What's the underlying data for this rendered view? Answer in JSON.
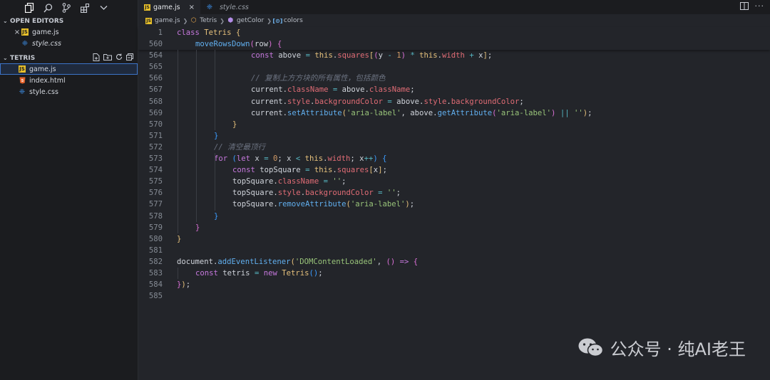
{
  "sidebar": {
    "open_editors_label": "OPEN EDITORS",
    "open_editors": [
      {
        "name": "game.js",
        "type": "js",
        "close": "×"
      },
      {
        "name": "style.css",
        "type": "css"
      }
    ],
    "folder_label": "TETRIS",
    "files": [
      {
        "name": "game.js",
        "type": "js"
      },
      {
        "name": "index.html",
        "type": "html"
      },
      {
        "name": "style.css",
        "type": "css"
      }
    ]
  },
  "tabs": [
    {
      "name": "game.js",
      "type": "js",
      "close": "×"
    },
    {
      "name": "style.css",
      "type": "css"
    }
  ],
  "breadcrumb": [
    "game.js",
    "Tetris",
    "getColor",
    "colors"
  ],
  "code": {
    "sticky_lines": [
      {
        "n": "1",
        "indent": 0,
        "tokens": [
          [
            "kw",
            "class "
          ],
          [
            "cls",
            "Tetris "
          ],
          [
            "b1",
            "{"
          ]
        ]
      },
      {
        "n": "560",
        "indent": 1,
        "tokens": [
          [
            "fn",
            "moveRowsDown"
          ],
          [
            "b2",
            "("
          ],
          [
            "p",
            "row"
          ],
          [
            "b2",
            ")"
          ],
          [
            "p",
            " "
          ],
          [
            "b2",
            "{"
          ]
        ]
      }
    ],
    "lines": [
      {
        "n": "564",
        "indent": 4,
        "tokens": [
          [
            "kw",
            "const "
          ],
          [
            "p",
            "above "
          ],
          [
            "op",
            "= "
          ],
          [
            "th",
            "this"
          ],
          [
            "p",
            "."
          ],
          [
            "prop",
            "squares"
          ],
          [
            "b1",
            "["
          ],
          [
            "b2",
            "("
          ],
          [
            "p",
            "y "
          ],
          [
            "op",
            "- "
          ],
          [
            "num",
            "1"
          ],
          [
            "b2",
            ")"
          ],
          [
            "p",
            " "
          ],
          [
            "op",
            "* "
          ],
          [
            "th",
            "this"
          ],
          [
            "p",
            "."
          ],
          [
            "prop",
            "width "
          ],
          [
            "op",
            "+ "
          ],
          [
            "p",
            "x"
          ],
          [
            "b1",
            "]"
          ],
          [
            "p",
            ";"
          ]
        ]
      },
      {
        "n": "565",
        "indent": 0,
        "tokens": []
      },
      {
        "n": "566",
        "indent": 4,
        "tokens": [
          [
            "cm",
            "// 复制上方方块的所有属性，包括颜色"
          ]
        ]
      },
      {
        "n": "567",
        "indent": 4,
        "tokens": [
          [
            "p",
            "current"
          ],
          [
            "p",
            "."
          ],
          [
            "prop",
            "className "
          ],
          [
            "op",
            "= "
          ],
          [
            "p",
            "above"
          ],
          [
            "p",
            "."
          ],
          [
            "prop",
            "className"
          ],
          [
            "p",
            ";"
          ]
        ]
      },
      {
        "n": "568",
        "indent": 4,
        "tokens": [
          [
            "p",
            "current"
          ],
          [
            "p",
            "."
          ],
          [
            "prop",
            "style"
          ],
          [
            "p",
            "."
          ],
          [
            "prop",
            "backgroundColor "
          ],
          [
            "op",
            "= "
          ],
          [
            "p",
            "above"
          ],
          [
            "p",
            "."
          ],
          [
            "prop",
            "style"
          ],
          [
            "p",
            "."
          ],
          [
            "prop",
            "backgroundColor"
          ],
          [
            "p",
            ";"
          ]
        ]
      },
      {
        "n": "569",
        "indent": 4,
        "tokens": [
          [
            "p",
            "current"
          ],
          [
            "p",
            "."
          ],
          [
            "fn",
            "setAttribute"
          ],
          [
            "b1",
            "("
          ],
          [
            "str",
            "'aria-label'"
          ],
          [
            "p",
            ", above."
          ],
          [
            "fn",
            "getAttribute"
          ],
          [
            "b2",
            "("
          ],
          [
            "str",
            "'aria-label'"
          ],
          [
            "b2",
            ")"
          ],
          [
            "p",
            " "
          ],
          [
            "op",
            "|| "
          ],
          [
            "str",
            "''"
          ],
          [
            "b1",
            ")"
          ],
          [
            "p",
            ";"
          ]
        ]
      },
      {
        "n": "570",
        "indent": 3,
        "tokens": [
          [
            "b1",
            "}"
          ]
        ]
      },
      {
        "n": "571",
        "indent": 2,
        "tokens": [
          [
            "b3",
            "}"
          ]
        ]
      },
      {
        "n": "572",
        "indent": 2,
        "tokens": [
          [
            "cm",
            "// 清空最顶行"
          ]
        ]
      },
      {
        "n": "573",
        "indent": 2,
        "tokens": [
          [
            "kw",
            "for "
          ],
          [
            "b3",
            "("
          ],
          [
            "kw",
            "let "
          ],
          [
            "p",
            "x "
          ],
          [
            "op",
            "= "
          ],
          [
            "num",
            "0"
          ],
          [
            "p",
            "; x "
          ],
          [
            "op",
            "< "
          ],
          [
            "th",
            "this"
          ],
          [
            "p",
            "."
          ],
          [
            "prop",
            "width"
          ],
          [
            "p",
            "; x"
          ],
          [
            "op",
            "++"
          ],
          [
            "b3",
            ")"
          ],
          [
            "p",
            " "
          ],
          [
            "b3",
            "{"
          ]
        ]
      },
      {
        "n": "574",
        "indent": 3,
        "tokens": [
          [
            "kw",
            "const "
          ],
          [
            "p",
            "topSquare "
          ],
          [
            "op",
            "= "
          ],
          [
            "th",
            "this"
          ],
          [
            "p",
            "."
          ],
          [
            "prop",
            "squares"
          ],
          [
            "b1",
            "["
          ],
          [
            "p",
            "x"
          ],
          [
            "b1",
            "]"
          ],
          [
            "p",
            ";"
          ]
        ]
      },
      {
        "n": "575",
        "indent": 3,
        "tokens": [
          [
            "p",
            "topSquare"
          ],
          [
            "p",
            "."
          ],
          [
            "prop",
            "className "
          ],
          [
            "op",
            "= "
          ],
          [
            "str",
            "''"
          ],
          [
            "p",
            ";"
          ]
        ]
      },
      {
        "n": "576",
        "indent": 3,
        "tokens": [
          [
            "p",
            "topSquare"
          ],
          [
            "p",
            "."
          ],
          [
            "prop",
            "style"
          ],
          [
            "p",
            "."
          ],
          [
            "prop",
            "backgroundColor "
          ],
          [
            "op",
            "= "
          ],
          [
            "str",
            "''"
          ],
          [
            "p",
            ";"
          ]
        ]
      },
      {
        "n": "577",
        "indent": 3,
        "tokens": [
          [
            "p",
            "topSquare"
          ],
          [
            "p",
            "."
          ],
          [
            "fn",
            "removeAttribute"
          ],
          [
            "b1",
            "("
          ],
          [
            "str",
            "'aria-label'"
          ],
          [
            "b1",
            ")"
          ],
          [
            "p",
            ";"
          ]
        ]
      },
      {
        "n": "578",
        "indent": 2,
        "tokens": [
          [
            "b3",
            "}"
          ]
        ]
      },
      {
        "n": "579",
        "indent": 1,
        "tokens": [
          [
            "b2",
            "}"
          ]
        ]
      },
      {
        "n": "580",
        "indent": 0,
        "tokens": [
          [
            "b1",
            "}"
          ]
        ]
      },
      {
        "n": "581",
        "indent": 0,
        "tokens": []
      },
      {
        "n": "582",
        "indent": 0,
        "tokens": [
          [
            "p",
            "document"
          ],
          [
            "p",
            "."
          ],
          [
            "fn",
            "addEventListener"
          ],
          [
            "b1",
            "("
          ],
          [
            "str",
            "'DOMContentLoaded'"
          ],
          [
            "p",
            ", "
          ],
          [
            "b2",
            "()"
          ],
          [
            "p",
            " "
          ],
          [
            "kw",
            "=> "
          ],
          [
            "b2",
            "{"
          ]
        ]
      },
      {
        "n": "583",
        "indent": 1,
        "tokens": [
          [
            "kw",
            "const "
          ],
          [
            "p",
            "tetris "
          ],
          [
            "op",
            "= "
          ],
          [
            "kw",
            "new "
          ],
          [
            "cls",
            "Tetris"
          ],
          [
            "b3",
            "()"
          ],
          [
            "p",
            ";"
          ]
        ]
      },
      {
        "n": "584",
        "indent": 0,
        "tokens": [
          [
            "b2",
            "}"
          ],
          [
            "b1",
            ")"
          ],
          [
            "p",
            ";"
          ]
        ]
      },
      {
        "n": "585",
        "indent": 0,
        "tokens": []
      }
    ]
  },
  "watermark": {
    "text": "公众号 · 纯AI老王"
  }
}
